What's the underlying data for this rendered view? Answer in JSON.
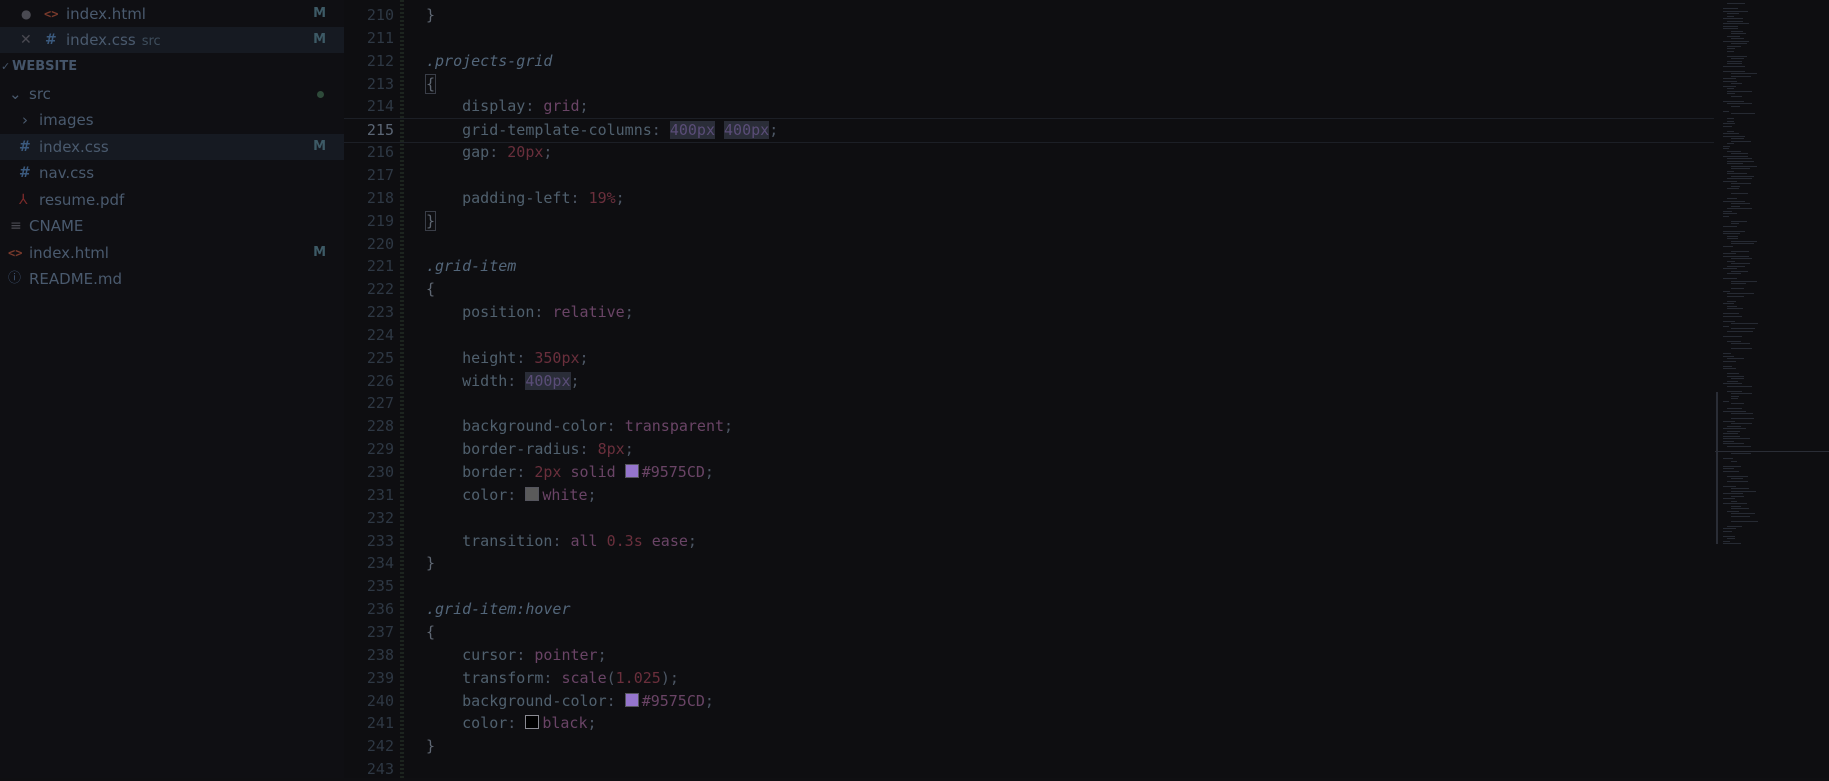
{
  "open_editors": [
    {
      "name": "index.html",
      "sub": "",
      "icon": "html-icon",
      "badge": "M",
      "marker": "●"
    },
    {
      "name": "index.css",
      "sub": "src",
      "icon": "css-icon",
      "badge": "M",
      "marker": "✕"
    }
  ],
  "explorer": {
    "section_title": "WEBSITE",
    "section_chevron": "✓",
    "items": [
      {
        "name": "src",
        "chevron": "⌄",
        "icon": "folder-open-icon"
      },
      {
        "name": "images",
        "chevron": "›",
        "icon": "folder-icon"
      },
      {
        "name": "index.css",
        "glyph": "#",
        "icon": "css-icon",
        "badge": "M"
      },
      {
        "name": "nav.css",
        "glyph": "#",
        "icon": "css-icon",
        "badge": ""
      },
      {
        "name": "resume.pdf",
        "glyph": "⅄",
        "icon": "pdf-icon",
        "badge": ""
      },
      {
        "name": "CNAME",
        "glyph": "≡",
        "icon": "text-file-icon",
        "badge": ""
      },
      {
        "name": "index.html",
        "glyph": "<>",
        "icon": "html-icon",
        "badge": "M"
      },
      {
        "name": "README.md",
        "glyph": "ⓘ",
        "icon": "info-icon",
        "badge": ""
      }
    ]
  },
  "colors": {
    "swatch_purple": "#9575CD",
    "swatch_white": "#5a5a5a",
    "swatch_black": "#000000"
  },
  "editor": {
    "active_line": "215",
    "lines": [
      {
        "n": "210",
        "t": "}"
      },
      {
        "n": "211",
        "t": ""
      },
      {
        "n": "212",
        "t": ".projects-grid"
      },
      {
        "n": "213",
        "t": "{"
      },
      {
        "n": "214",
        "p": "display",
        "v": "grid"
      },
      {
        "n": "215",
        "p": "grid-template-columns",
        "v1": "400px",
        "v2": "400px"
      },
      {
        "n": "216",
        "p": "gap",
        "v": "20px"
      },
      {
        "n": "217",
        "t": ""
      },
      {
        "n": "218",
        "p": "padding-left",
        "v": "19%"
      },
      {
        "n": "219",
        "t": "}"
      },
      {
        "n": "220",
        "t": ""
      },
      {
        "n": "221",
        "t": ".grid-item"
      },
      {
        "n": "222",
        "t": "{"
      },
      {
        "n": "223",
        "p": "position",
        "v": "relative"
      },
      {
        "n": "224",
        "t": ""
      },
      {
        "n": "225",
        "p": "height",
        "v": "350px"
      },
      {
        "n": "226",
        "p": "width",
        "v": "400px"
      },
      {
        "n": "227",
        "t": ""
      },
      {
        "n": "228",
        "p": "background-color",
        "v": "transparent"
      },
      {
        "n": "229",
        "p": "border-radius",
        "v": "8px"
      },
      {
        "n": "230",
        "p": "border",
        "v1": "2px",
        "v2": "solid",
        "v3": "#9575CD"
      },
      {
        "n": "231",
        "p": "color",
        "v": "white"
      },
      {
        "n": "232",
        "t": ""
      },
      {
        "n": "233",
        "p": "transition",
        "v1": "all",
        "v2": "0.3s",
        "v3": "ease"
      },
      {
        "n": "234",
        "t": "}"
      },
      {
        "n": "235",
        "t": ""
      },
      {
        "n": "236",
        "t": ".grid-item:hover"
      },
      {
        "n": "237",
        "t": "{"
      },
      {
        "n": "238",
        "p": "cursor",
        "v": "pointer"
      },
      {
        "n": "239",
        "p": "transform",
        "v1": "scale",
        "v2": "1.025"
      },
      {
        "n": "240",
        "p": "background-color",
        "v": "#9575CD"
      },
      {
        "n": "241",
        "p": "color",
        "v": "black"
      },
      {
        "n": "242",
        "t": "}"
      },
      {
        "n": "243",
        "t": ""
      }
    ]
  }
}
